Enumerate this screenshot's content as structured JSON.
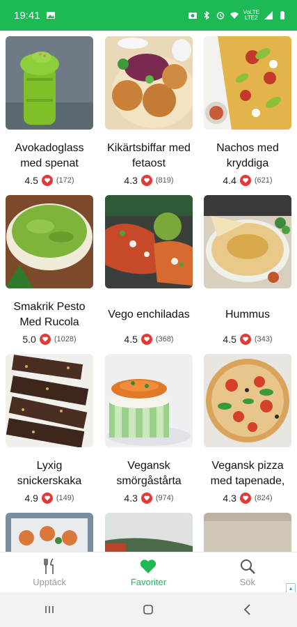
{
  "status_bar": {
    "time": "19:41",
    "volte_top": "VoLTE",
    "volte_bottom": "LTE2",
    "icons": [
      "gallery-icon",
      "camera-icon",
      "bluetooth-icon",
      "alarm-icon",
      "wifi-icon",
      "signal-icon",
      "battery-icon"
    ]
  },
  "recipes": [
    {
      "title": "Avokadoglass med spenat",
      "rating": "4.5",
      "count": "(172)"
    },
    {
      "title": "Kikärtsbiffar med fetaost",
      "rating": "4.3",
      "count": "(819)"
    },
    {
      "title": "Nachos med kryddiga",
      "rating": "4.4",
      "count": "(621)"
    },
    {
      "title": "Smakrik Pesto Med Rucola",
      "rating": "5.0",
      "count": "(1028)"
    },
    {
      "title": "Vego enchiladas",
      "rating": "4.5",
      "count": "(368)"
    },
    {
      "title": "Hummus",
      "rating": "4.5",
      "count": "(343)"
    },
    {
      "title": "Lyxig snickerskaka",
      "rating": "4.9",
      "count": "(149)"
    },
    {
      "title": "Vegansk smörgåstårta",
      "rating": "4.3",
      "count": "(974)"
    },
    {
      "title": "Vegansk pizza med tapenade,",
      "rating": "4.3",
      "count": "(824)"
    }
  ],
  "bottom_nav": {
    "items": [
      {
        "label": "Upptäck",
        "icon": "fork-knife-icon",
        "active": false
      },
      {
        "label": "Favoriter",
        "icon": "heart-icon",
        "active": true
      },
      {
        "label": "Sök",
        "icon": "search-icon",
        "active": false
      }
    ]
  },
  "colors": {
    "brand_green": "#1db954",
    "rating_badge": "#e53935",
    "inactive_nav": "#999999"
  }
}
